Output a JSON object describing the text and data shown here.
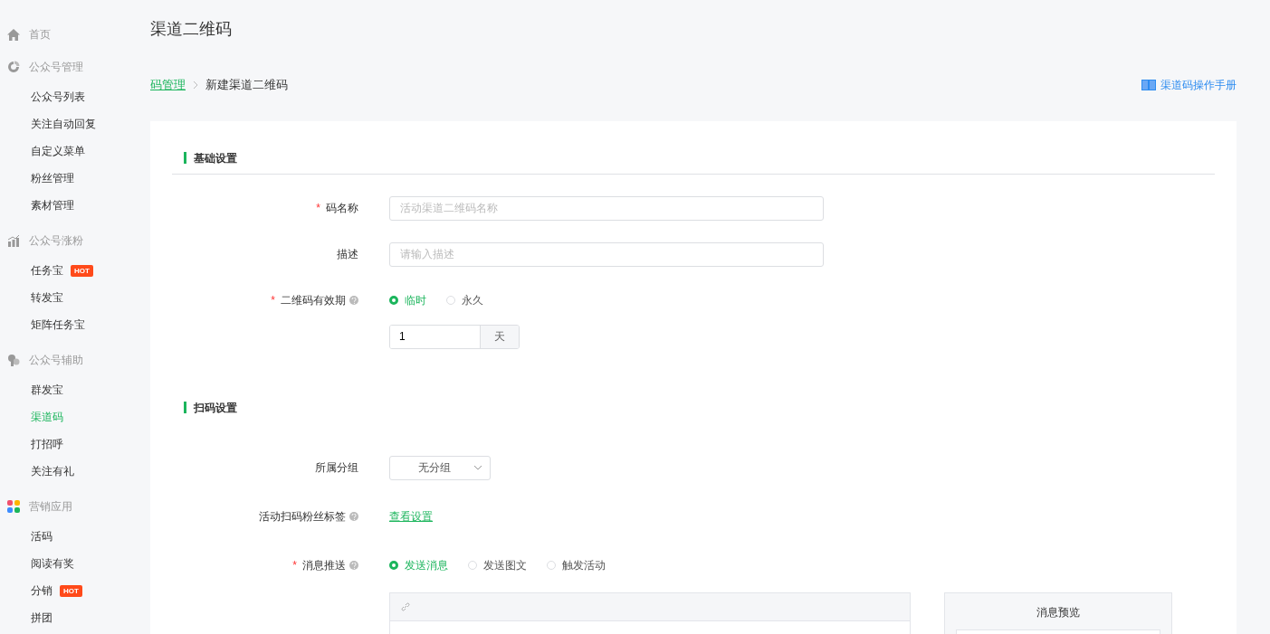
{
  "sidebar": {
    "sections": [
      {
        "label": "首页"
      },
      {
        "label": "公众号管理",
        "items": [
          {
            "label": "公众号列表",
            "selected": false
          },
          {
            "label": "关注自动回复",
            "selected": false
          },
          {
            "label": "自定义菜单",
            "selected": false
          },
          {
            "label": "粉丝管理",
            "selected": false
          },
          {
            "label": "素材管理",
            "selected": false
          }
        ]
      },
      {
        "label": "公众号涨粉",
        "items": [
          {
            "label": "任务宝",
            "badge": "HOT",
            "selected": false
          },
          {
            "label": "转发宝",
            "selected": false
          },
          {
            "label": "矩阵任务宝",
            "selected": false
          }
        ]
      },
      {
        "label": "公众号辅助",
        "items": [
          {
            "label": "群发宝",
            "selected": false
          },
          {
            "label": "渠道码",
            "selected": true
          },
          {
            "label": "打招呼",
            "selected": false
          },
          {
            "label": "关注有礼",
            "selected": false
          }
        ]
      },
      {
        "label": "营销应用",
        "items": [
          {
            "label": "活码",
            "selected": false
          },
          {
            "label": "阅读有奖",
            "selected": false
          },
          {
            "label": "分销",
            "badge": "HOT",
            "selected": false
          },
          {
            "label": "拼团",
            "selected": false
          }
        ]
      }
    ]
  },
  "page_title": "渠道二维码",
  "breadcrumb": {
    "parent": "码管理",
    "current": "新建渠道二维码"
  },
  "manual_link": "渠道码操作手册",
  "sections": [
    {
      "title": "基础设置",
      "divider": true,
      "fields": [
        {
          "kind": "text",
          "label": "码名称",
          "required_mark": "*",
          "help": false,
          "placeholder": "活动渠道二维码名称"
        },
        {
          "kind": "text",
          "label": "描述",
          "help": false,
          "placeholder": "请输入描述"
        },
        {
          "kind": "radio",
          "label": "二维码有效期",
          "required_mark": "*",
          "help": true,
          "options": [
            {
              "label": "临时",
              "selected": true
            },
            {
              "label": "永久",
              "selected": false
            }
          ],
          "duration": {
            "value": "1",
            "unit": "天"
          }
        }
      ]
    },
    {
      "title": "扫码设置",
      "divider": false,
      "fields": [
        {
          "kind": "select",
          "label": "所属分组",
          "help": false,
          "value": "无分组"
        },
        {
          "kind": "link",
          "label": "活动扫码粉丝标签",
          "help": true,
          "link": "查看设置"
        },
        {
          "kind": "radio",
          "label": "消息推送",
          "required_mark": "*",
          "help": true,
          "options": [
            {
              "label": "发送消息",
              "selected": true
            },
            {
              "label": "发送图文",
              "selected": false
            },
            {
              "label": "触发活动",
              "selected": false
            }
          ]
        }
      ]
    }
  ],
  "preview": {
    "title": "消息预览"
  }
}
